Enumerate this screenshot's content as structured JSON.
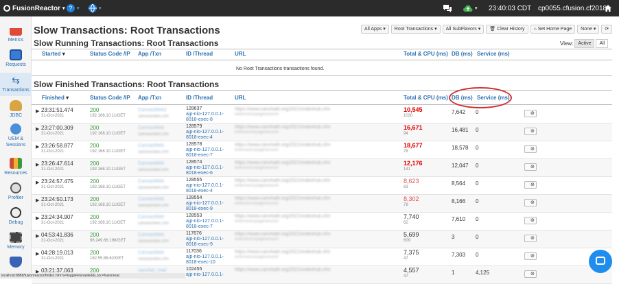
{
  "topbar": {
    "brand": "FusionReactor",
    "time": "23:40:03 CDT",
    "server": "cp0055.cfusion.cf2018"
  },
  "sidebar": {
    "items": [
      {
        "label": "Metrics",
        "icon": "metrics-icon"
      },
      {
        "label": "Requests",
        "icon": "requests-icon"
      },
      {
        "label": "Transactions",
        "icon": "transactions-icon",
        "active": true
      },
      {
        "label": "JDBC",
        "icon": "jdbc-icon"
      },
      {
        "label": "UEM & Sessions",
        "icon": "uem-sessions-icon"
      },
      {
        "label": "Resources",
        "icon": "resources-icon"
      },
      {
        "label": "Profiler",
        "icon": "profiler-icon"
      },
      {
        "label": "Debug",
        "icon": "debug-icon"
      },
      {
        "label": "Memory",
        "icon": "memory-icon"
      },
      {
        "label": "",
        "icon": "shield-icon"
      }
    ]
  },
  "page": {
    "title": "Slow Transactions: Root Transactions",
    "toolbar": [
      "All Apps ▾",
      "Root Transactions ▾",
      "All SubFlavors ▾",
      "Clear History",
      "Set Home Page",
      "None ▾",
      "⟳"
    ]
  },
  "running": {
    "title": "Slow Running Transactions: Root Transactions",
    "view_label": "View:",
    "view_options": [
      "Active",
      "All"
    ],
    "columns": [
      "Started",
      "Status Code /IP",
      "App /Txn",
      "ID /Thread",
      "URL",
      "Total & CPU (ms)",
      "DB (ms)",
      "Service (ms)"
    ],
    "empty_message": "No Root Transactions transactions found."
  },
  "finished": {
    "title": "Slow Finished Transactions: Root Transactions",
    "columns": [
      "Finished",
      "Status Code /IP",
      "App /Txn",
      "ID /Thread",
      "URL",
      "Total & CPU (ms)",
      "DB (ms)",
      "Service (ms)"
    ],
    "rows": [
      {
        "time": "23:31:51.474",
        "date": "31-Oct-2021",
        "code": "200",
        "ip": "192.168.10.11/GET",
        "app": "CanvasWeb2",
        "app2": "canvasindex.cfm",
        "id": "128637",
        "thread": "ajp-nio-127.0.0.1-8018-exec-8",
        "url": "https://www.canvhattr.org/2021/indexhub.cfm",
        "url2": "extensions/pagesession",
        "total": "10,545",
        "cpu": "1030",
        "db": "7,642",
        "svc": "0",
        "color": "#e00000",
        "bold": true
      },
      {
        "time": "23:27:00.309",
        "date": "31-Oct-2021",
        "code": "200",
        "ip": "192.168.10.11/GET",
        "app": "CanvasWeb",
        "app2": "canvasindex.cfm",
        "id": "128579",
        "thread": "ajp-nio-127.0.0.1-8018-exec-4",
        "url": "https://www.canvhattr.org/2021/indexhub.cfm",
        "url2": "extensions/pagesession",
        "total": "16,671",
        "cpu": "94",
        "db": "16,481",
        "svc": "0",
        "color": "#e00000",
        "bold": true
      },
      {
        "time": "23:26:58.877",
        "date": "31-Oct-2021",
        "code": "200",
        "ip": "192.168.10.11/GET",
        "app": "CanvasWeb",
        "app2": "canvasindex.cfm",
        "id": "128578",
        "thread": "ajp-nio-127.0.0.1-8018-exec-7",
        "url": "https://www.canvhattr.org/2021/indexhub.cfm",
        "url2": "extensions/pagesession",
        "total": "18,677",
        "cpu": "78",
        "db": "18,578",
        "svc": "0",
        "color": "#e00000",
        "bold": true
      },
      {
        "time": "23:26:47.614",
        "date": "31-Oct-2021",
        "code": "200",
        "ip": "192.168.10.11/GET",
        "app": "CanvasWeb",
        "app2": "canvasindex.cfm",
        "id": "128574",
        "thread": "ajp-nio-127.0.0.1-8018-exec-6",
        "url": "https://www.canvhattr.org/2021/indexhub.cfm",
        "url2": "extensions/pagesession",
        "total": "12,176",
        "cpu": "141",
        "db": "12,047",
        "svc": "0",
        "color": "#e00000",
        "bold": true
      },
      {
        "time": "23:24:57.475",
        "date": "31-Oct-2021",
        "code": "200",
        "ip": "192.168.10.11/GET",
        "app": "CanvasWeb",
        "app2": "canvasindex.cfm",
        "id": "128555",
        "thread": "ajp-nio-127.0.0.1-8018-exec-4",
        "url": "https://www.canvhattr.org/2021/indexhub.cfm",
        "url2": "extensions/pagesession",
        "total": "8,623",
        "cpu": "63",
        "db": "8,564",
        "svc": "0",
        "color": "#e05050",
        "bold": false
      },
      {
        "time": "23:24:50.173",
        "date": "31-Oct-2021",
        "code": "200",
        "ip": "192.168.10.11/GET",
        "app": "CanvasWeb",
        "app2": "canvasindex.cfm",
        "id": "128554",
        "thread": "ajp-nio-127.0.0.1-8018-exec-9",
        "url": "https://www.canvhattr.org/2021/indexhub.cfm",
        "url2": "extensions/pagesession",
        "total": "8,302",
        "cpu": "78",
        "db": "8,166",
        "svc": "0",
        "color": "#e05050",
        "bold": false
      },
      {
        "time": "23:24:34.907",
        "date": "31-Oct-2021",
        "code": "200",
        "ip": "192.168.10.11/GET",
        "app": "CanvasWeb",
        "app2": "canvasindex.cfm",
        "id": "128553",
        "thread": "ajp-nio-127.0.0.1-8018-exec-7",
        "url": "https://www.canvhattr.org/2021/indexhub.cfm",
        "url2": "extensions/pagesession",
        "total": "7,740",
        "cpu": "62",
        "db": "7,610",
        "svc": "0",
        "color": "#333333",
        "bold": false
      },
      {
        "time": "04:53:41.836",
        "date": "31-Oct-2021",
        "code": "200",
        "ip": "66.249.66.196/GET",
        "app": "CanvasWeb",
        "app2": "canvasindex.cfm",
        "id": "117676",
        "thread": "ajp-nio-127.0.0.1-8018-exec-9",
        "url": "https://www.canvhattr.org/2021/indexhub.cfm",
        "url2": "extensions/pagesession",
        "total": "5,699",
        "cpu": "609",
        "db": "3",
        "svc": "0",
        "color": "#333333",
        "bold": false
      },
      {
        "time": "04:28:19.013",
        "date": "31-Oct-2021",
        "code": "200",
        "ip": "162.55.86.62/GET",
        "app": "CanvasWeb",
        "app2": "canvasindex.cfm",
        "id": "117036",
        "thread": "ajp-nio-127.0.0.1-8018-exec-10",
        "url": "https://www.canvhattr.org/2021/indexhub.cfm",
        "url2": "extensions/pagesession",
        "total": "7,375",
        "cpu": "47",
        "db": "7,303",
        "svc": "0",
        "color": "#333333",
        "bold": false
      },
      {
        "time": "03:21:37.063",
        "date": "31-Oct-2021",
        "code": "200",
        "ip": "",
        "app": "canvhat_mail",
        "app2": "canvasindex.cfm",
        "id": "102455",
        "thread": "ajp-nio-127.0.0.1-",
        "url": "https://www.canvhattr.org/2021/indexhub.cfm",
        "url2": "",
        "total": "4,557",
        "cpu": "47",
        "db": "1",
        "svc": "4,125",
        "color": "#333333",
        "bold": false
      }
    ]
  },
  "statusbar": "localhost:8888/fusionreactor/fmdec.htm?a=toggleFrEnabled&t_toc=fusionreac"
}
